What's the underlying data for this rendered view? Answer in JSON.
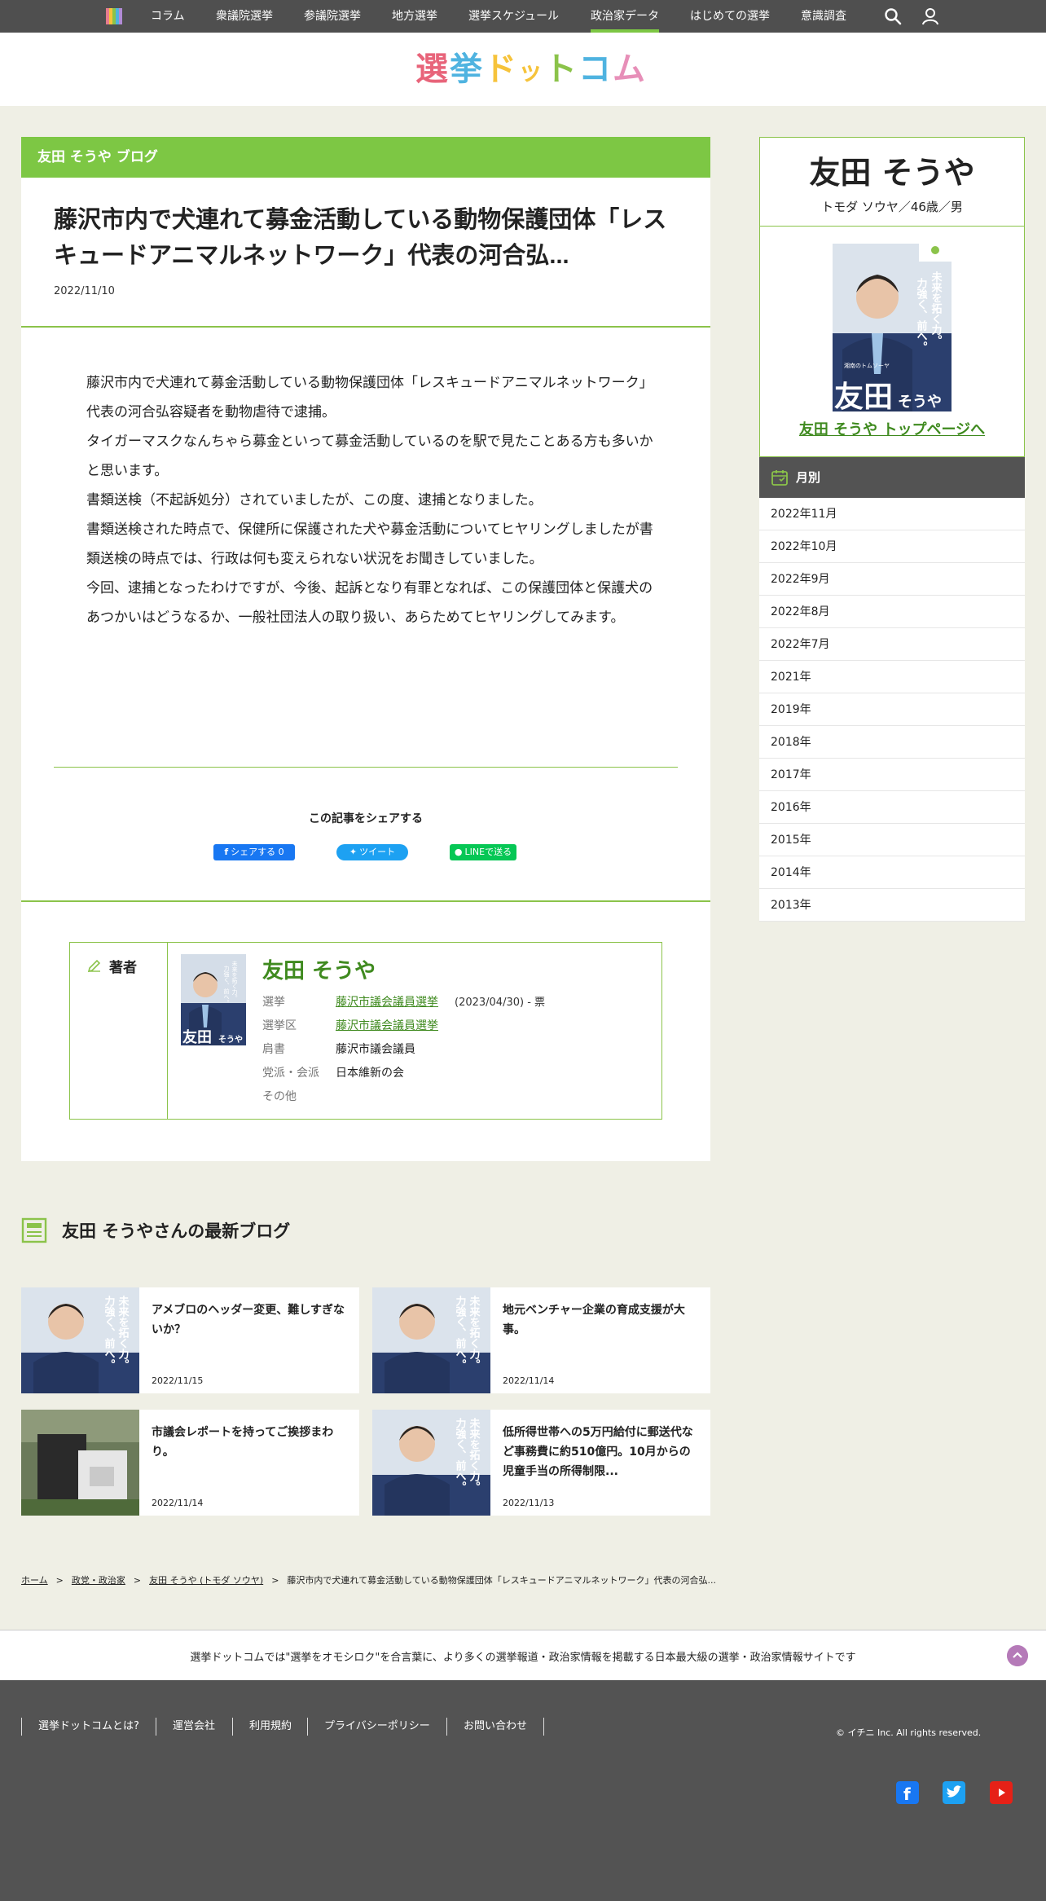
{
  "nav": {
    "items": [
      "コラム",
      "衆議院選挙",
      "参議院選挙",
      "地方選挙",
      "選挙スケジュール",
      "政治家データ",
      "はじめての選挙",
      "意識調査"
    ],
    "active_index": 5
  },
  "site_logo_text": [
    "選",
    "挙",
    "ド",
    "ッ",
    "ト",
    "コ",
    "ム"
  ],
  "site_logo_colors": [
    "#e8647a",
    "#4fb3e0",
    "#f6c33b",
    "#f6c33b",
    "#8bc34a",
    "#4fb3e0",
    "#e78fb8"
  ],
  "blog_label": "友田 そうや ブログ",
  "article": {
    "title": "藤沢市内で犬連れて募金活動している動物保護団体「レスキュードアニマルネットワーク」代表の河合弘...",
    "date": "2022/11/10",
    "paragraphs": [
      "藤沢市内で犬連れて募金活動している動物保護団体「レスキュードアニマルネットワーク」代表の河合弘容疑者を動物虐待で逮捕。",
      "タイガーマスクなんちゃら募金といって募金活動しているのを駅で見たことある方も多いかと思います。",
      "書類送検（不起訴処分）されていましたが、この度、逮捕となりました。",
      "書類送検された時点で、保健所に保護された犬や募金活動についてヒヤリングしましたが書類送検の時点では、行政は何も変えられない状況をお聞きしていました。",
      "今回、逮捕となったわけですが、今後、起訴となり有罪となれば、この保護団体と保護犬のあつかいはどうなるか、一般社団法人の取り扱い、あらためてヒヤリングしてみます。"
    ]
  },
  "share": {
    "title": "この記事をシェアする",
    "facebook": "シェアする 0",
    "twitter": "ツイート",
    "line": "LINEで送る"
  },
  "author": {
    "label": "著者",
    "name": "友田 そうや",
    "rows": {
      "election_key": "選挙",
      "election_value": "藤沢市議会議員選挙",
      "election_extra": "(2023/04/30) - 票",
      "district_key": "選挙区",
      "district_value": "藤沢市議会議員選挙",
      "title_key": "肩書",
      "title_value": "藤沢市議会議員",
      "party_key": "党派・会派",
      "party_value": "日本維新の会",
      "other_key": "その他"
    }
  },
  "profile": {
    "name": "友田 そうや",
    "sub": "トモダ ソウヤ／46歳／男",
    "top_link": "友田 そうや トップページへ",
    "poster": {
      "slogan1": "未来を拓く力。",
      "slogan2": "力強く、前へ。",
      "name_big": "友田",
      "name_small": "そうや",
      "caption": "湘南のトムソーヤ"
    }
  },
  "monthly": {
    "title": "月別",
    "items": [
      "2022年11月",
      "2022年10月",
      "2022年9月",
      "2022年8月",
      "2022年7月",
      "2021年",
      "2019年",
      "2018年",
      "2017年",
      "2016年",
      "2015年",
      "2014年",
      "2013年"
    ]
  },
  "latest": {
    "title": "友田 そうやさんの最新ブログ",
    "cards": [
      {
        "title": "アメブロのヘッダー変更、難しすぎないか？",
        "date": "2022/11/15"
      },
      {
        "title": "地元ベンチャー企業の育成支援が大事。",
        "date": "2022/11/14"
      },
      {
        "title": "市議会レポートを持ってご挨拶まわり。",
        "date": "2022/11/14"
      },
      {
        "title": "低所得世帯への5万円給付に郵送代など事務費に約510億円。10月からの児童手当の所得制限...",
        "date": "2022/11/13"
      }
    ]
  },
  "breadcrumb": {
    "home": "ホーム",
    "policy": "政党・政治家",
    "person": "友田 そうや (トモダ ソウヤ)",
    "current": "藤沢市内で犬連れて募金活動している動物保護団体「レスキュードアニマルネットワーク」代表の河合弘..."
  },
  "tagline": "選挙ドットコムでは\"選挙をオモシロク\"を合言葉に、より多くの選挙報道・政治家情報を掲載する日本最大級の選挙・政治家情報サイトです",
  "footer": {
    "links": [
      "選挙ドットコムとは?",
      "運営会社",
      "利用規約",
      "プライバシーポリシー",
      "お問い合わせ"
    ],
    "copyright": "© イチニ Inc. All rights reserved."
  },
  "colors": {
    "accent_green": "#7dc744",
    "link_green": "#3f8a1f",
    "dark_gray": "#535353"
  }
}
